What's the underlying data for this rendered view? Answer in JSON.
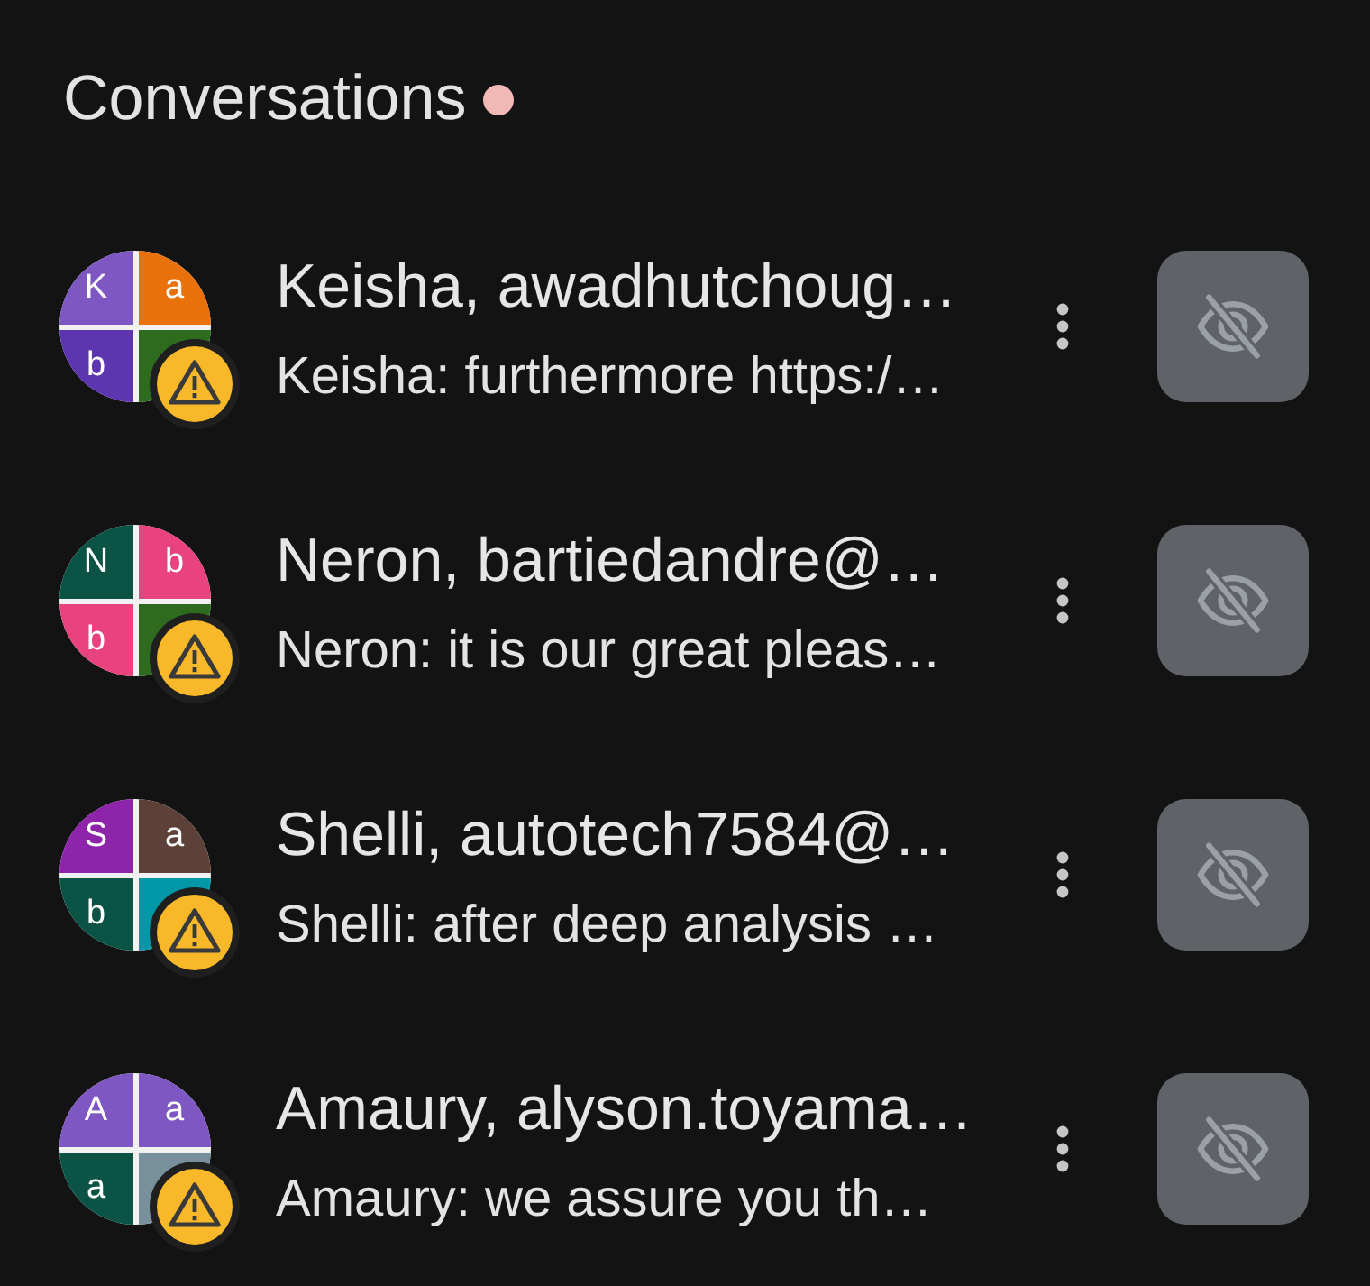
{
  "header": {
    "title": "Conversations",
    "unread": true
  },
  "conversations": [
    {
      "title": "Keisha, awadhutchoug…",
      "preview": "Keisha: furthermore https:/…",
      "warning": true,
      "avatar": [
        {
          "letter": "K",
          "color": "#7e57c2"
        },
        {
          "letter": "a",
          "color": "#e8710a"
        },
        {
          "letter": "b",
          "color": "#5e35b1"
        },
        {
          "color": "#2e6b1f"
        }
      ]
    },
    {
      "title": "Neron, bartiedandre@…",
      "preview": "Neron: it is our great pleas…",
      "warning": true,
      "avatar": [
        {
          "letter": "N",
          "color": "#0b5345"
        },
        {
          "letter": "b",
          "color": "#e8437f"
        },
        {
          "letter": "b",
          "color": "#e8437f"
        },
        {
          "color": "#2e6b1f"
        }
      ]
    },
    {
      "title": "Shelli, autotech7584@…",
      "preview": "Shelli: after deep analysis …",
      "warning": true,
      "avatar": [
        {
          "letter": "S",
          "color": "#8e24aa"
        },
        {
          "letter": "a",
          "color": "#5d4037"
        },
        {
          "letter": "b",
          "color": "#0b5345"
        },
        {
          "color": "#0097a7"
        }
      ]
    },
    {
      "title": "Amaury, alyson.toyama…",
      "preview": "Amaury: we assure you th…",
      "warning": true,
      "avatar": [
        {
          "letter": "A",
          "color": "#7e57c2"
        },
        {
          "letter": "a",
          "color": "#7e57c2"
        },
        {
          "letter": "a",
          "color": "#0b5345"
        },
        {
          "color": "#78909c"
        }
      ]
    }
  ]
}
